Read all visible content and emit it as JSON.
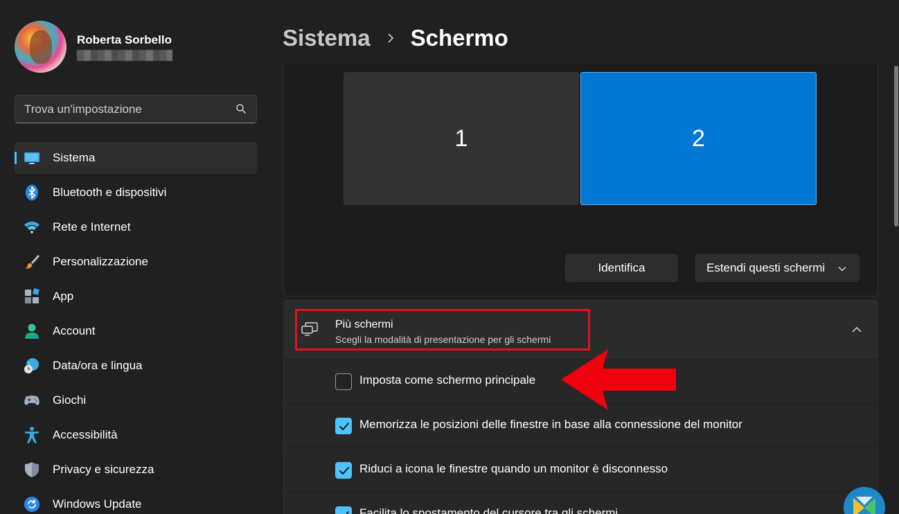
{
  "user": {
    "name": "Roberta Sorbello"
  },
  "search": {
    "placeholder": "Trova un'impostazione"
  },
  "nav": [
    {
      "label": "Sistema",
      "icon": "monitor-icon",
      "active": true
    },
    {
      "label": "Bluetooth e dispositivi",
      "icon": "bluetooth-icon"
    },
    {
      "label": "Rete e Internet",
      "icon": "wifi-icon"
    },
    {
      "label": "Personalizzazione",
      "icon": "brush-icon"
    },
    {
      "label": "App",
      "icon": "apps-icon"
    },
    {
      "label": "Account",
      "icon": "person-icon"
    },
    {
      "label": "Data/ora e lingua",
      "icon": "globe-clock-icon"
    },
    {
      "label": "Giochi",
      "icon": "gamepad-icon"
    },
    {
      "label": "Accessibilità",
      "icon": "accessibility-icon"
    },
    {
      "label": "Privacy e sicurezza",
      "icon": "shield-icon"
    },
    {
      "label": "Windows Update",
      "icon": "update-icon"
    }
  ],
  "breadcrumb": {
    "parent": "Sistema",
    "current": "Schermo"
  },
  "displays": {
    "monitor_1": "1",
    "monitor_2": "2",
    "selected": "2",
    "identify_label": "Identifica",
    "mode_label": "Estendi questi schermi"
  },
  "multi_display": {
    "title": "Più schermi",
    "subtitle": "Scegli la modalità di presentazione per gli schermi",
    "options": [
      {
        "label": "Imposta come schermo principale",
        "checked": false
      },
      {
        "label": "Memorizza le posizioni delle finestre in base alla connessione del monitor",
        "checked": true
      },
      {
        "label": "Riduci a icona le finestre quando un monitor è disconnesso",
        "checked": true
      },
      {
        "label": "Facilita lo spostamento del cursore tra gli schermi",
        "checked": true
      }
    ]
  },
  "colors": {
    "accent": "#4cc2ff",
    "selected_monitor": "#0078d4",
    "annotation_red": "#e4121c"
  }
}
